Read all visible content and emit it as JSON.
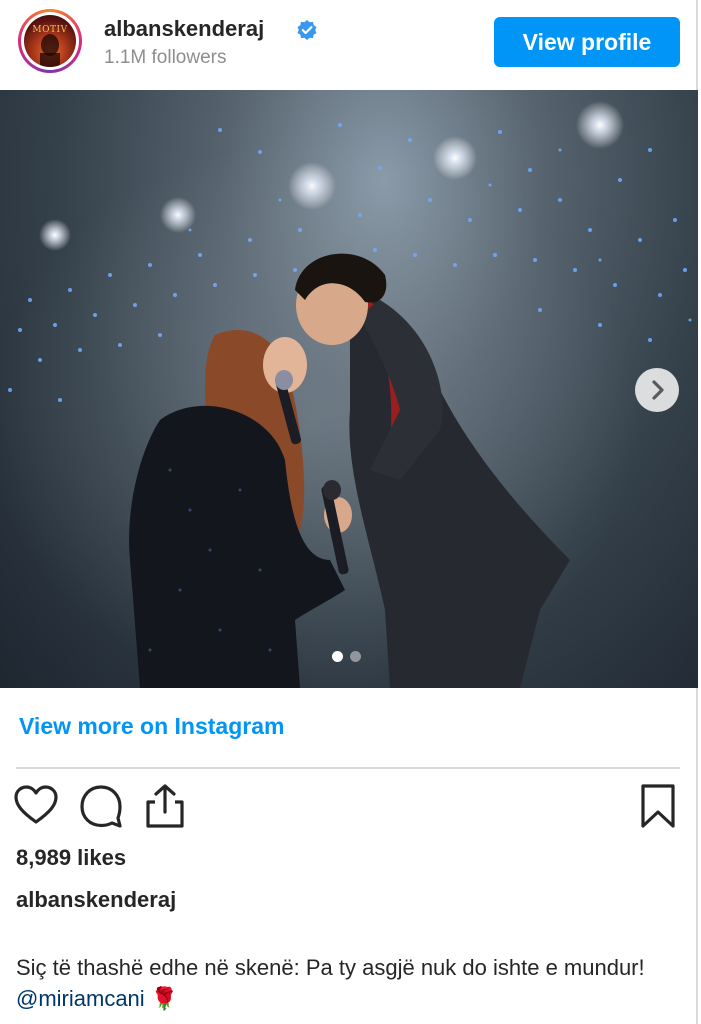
{
  "header": {
    "username": "albanskenderaj",
    "followers": "1.1M followers",
    "view_profile_label": "View profile",
    "avatar_logo_text": "MOTIV"
  },
  "post": {
    "image_alt": "Two performers kiss on stage under blue lights",
    "carousel": {
      "total": 2,
      "current": 1
    },
    "view_more_label": "View more on Instagram",
    "likes": "8,989 likes",
    "caption_user": "albanskenderaj",
    "caption_text": "Siç të thashë edhe në skenë: Pa ty asgjë nuk do ishte e mundur! ",
    "caption_mention": "@miriamcani",
    "caption_emoji": "🌹"
  },
  "icons": {
    "verified": "verified-badge-icon",
    "like": "heart-icon",
    "comment": "comment-icon",
    "share": "share-icon",
    "save": "bookmark-icon",
    "next": "chevron-right-icon"
  },
  "colors": {
    "accent": "#0095f6",
    "text": "#262626",
    "secondary_text": "#8e8e8e",
    "mention": "#00376b",
    "divider": "#dbdbdb"
  }
}
